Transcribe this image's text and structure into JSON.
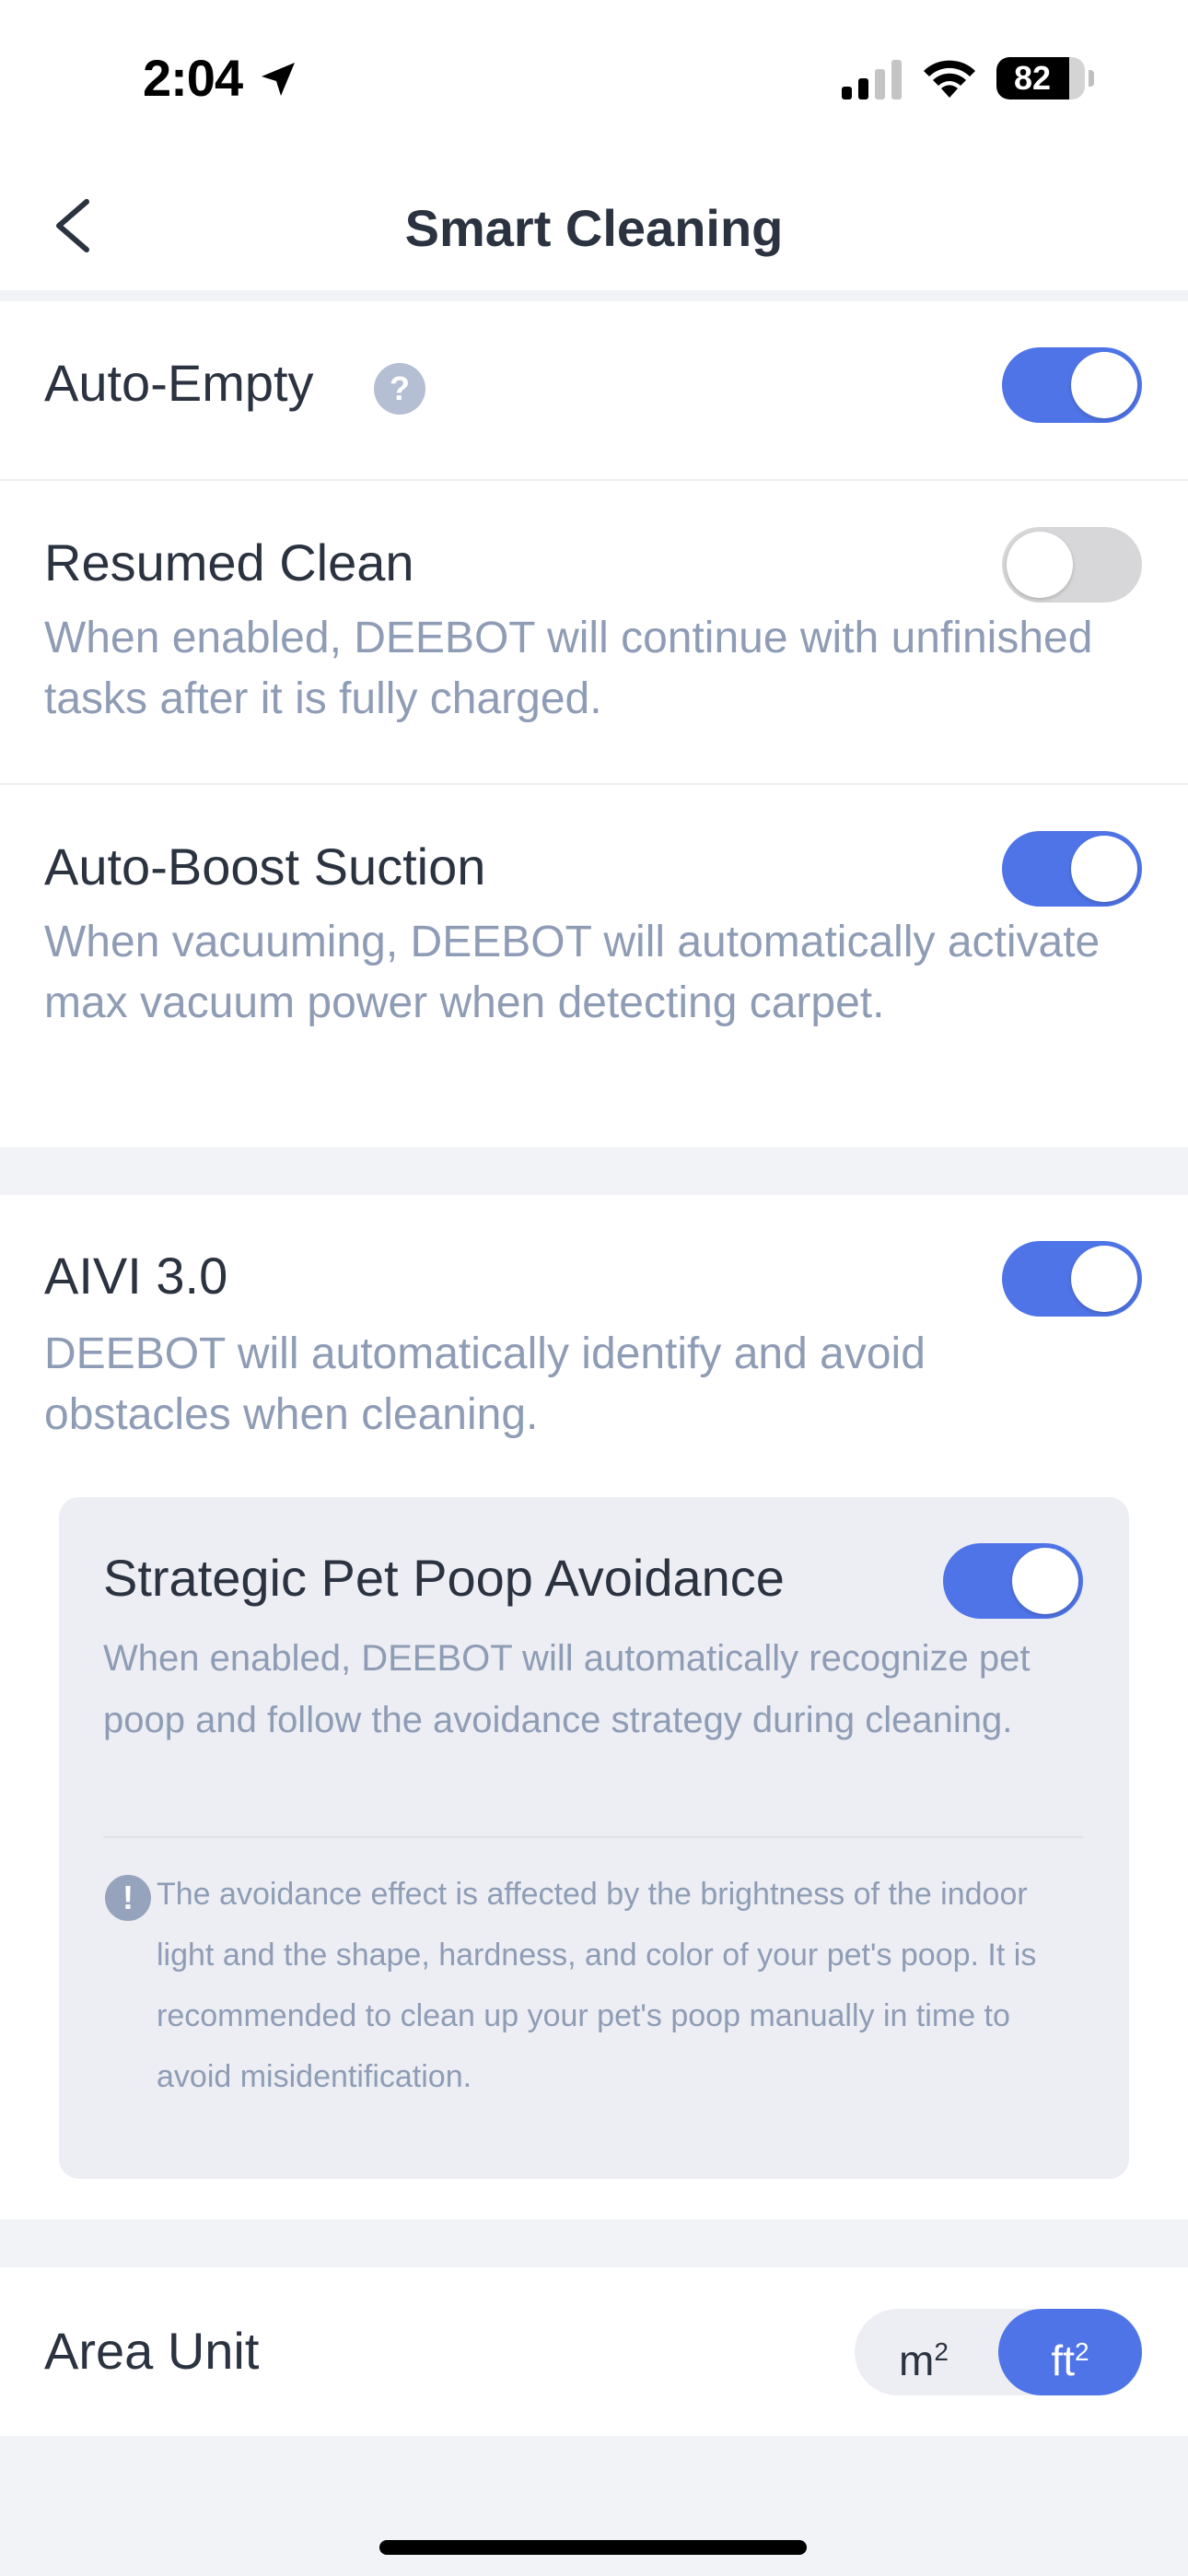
{
  "status_bar": {
    "time": "2:04",
    "battery_level": 82,
    "battery_label": "82"
  },
  "nav": {
    "title": "Smart Cleaning"
  },
  "settings": {
    "auto_empty": {
      "label": "Auto-Empty",
      "help_glyph": "?",
      "enabled": true
    },
    "resumed_clean": {
      "label": "Resumed Clean",
      "description": "When enabled, DEEBOT will continue with unfinished tasks after it is fully charged.",
      "enabled": false
    },
    "auto_boost": {
      "label": "Auto-Boost Suction",
      "description": "When vacuuming, DEEBOT will automatically activate max vacuum power when detecting carpet.",
      "enabled": true
    },
    "aivi": {
      "label": "AIVI 3.0",
      "description": "DEEBOT will automatically identify and avoid obstacles when cleaning.",
      "enabled": true
    },
    "pet_poop": {
      "label": "Strategic Pet Poop Avoidance",
      "description": "When enabled, DEEBOT will automatically recognize pet poop and follow the avoidance strategy during cleaning.",
      "warning_glyph": "!",
      "warning": "The avoidance effect is affected by the brightness of the indoor light and the shape, hardness, and color of your pet's poop. It is recommended to clean up your pet's poop manually in time to avoid misidentification.",
      "enabled": true
    },
    "area_unit": {
      "label": "Area Unit",
      "options": [
        {
          "base": "m",
          "exp": "2"
        },
        {
          "base": "ft",
          "exp": "2"
        }
      ],
      "selected": "ft²"
    }
  },
  "colors": {
    "accent": "#4f74e8",
    "toggle_off": "#d7d7d9",
    "secondary_text": "#8e9cb5",
    "page_background": "#f2f3f7"
  }
}
